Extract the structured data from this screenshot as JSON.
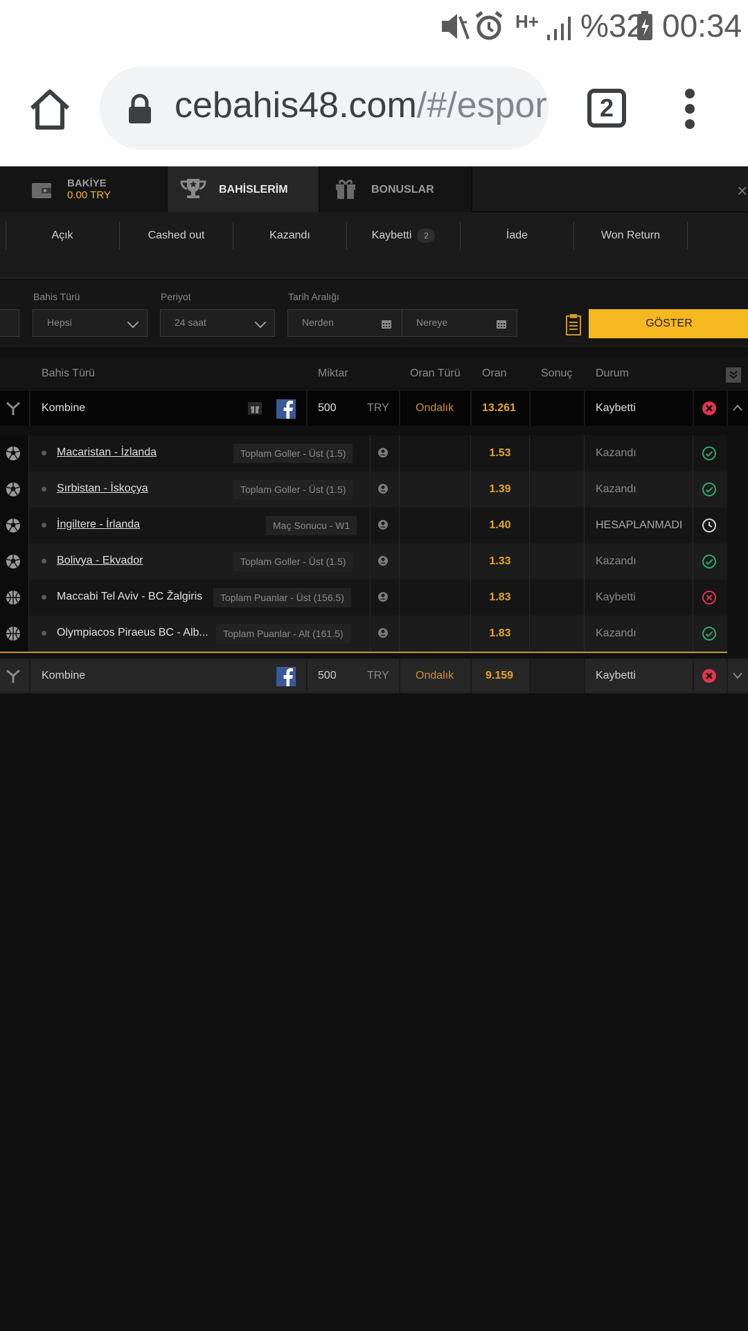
{
  "status_bar": {
    "battery": "%32",
    "time": "00:34",
    "network": "H+"
  },
  "browser": {
    "url_domain": "cebahis48.com",
    "url_path": "/#/espor",
    "tab_count": "2"
  },
  "top_nav": {
    "balance_label": "BAKİYE",
    "balance_value": "0.00 TRY",
    "bets_label": "BAHİSLERİM",
    "bonus_label": "BONUSLAR"
  },
  "filter_tabs": [
    {
      "label": "Açık"
    },
    {
      "label": "Cashed out"
    },
    {
      "label": "Kazandı"
    },
    {
      "label": "Kaybetti",
      "badge": "2"
    },
    {
      "label": "İade"
    },
    {
      "label": "Won Return"
    }
  ],
  "filters": {
    "bet_type_label": "Bahis Türü",
    "bet_type_value": "Hepsi",
    "period_label": "Periyot",
    "period_value": "24 saat",
    "date_range_label": "Tarih Aralığı",
    "from_placeholder": "Nerden",
    "to_placeholder": "Nereye",
    "show_button": "GÖSTER"
  },
  "table_headers": {
    "bet_type": "Bahis Türü",
    "amount": "Miktar",
    "odds_type": "Oran Türü",
    "odds": "Oran",
    "result": "Sonuç",
    "status": "Durum"
  },
  "bets": [
    {
      "type": "Kombine",
      "amount": "500",
      "currency": "TRY",
      "odds_type": "Ondalık",
      "odds": "13.261",
      "status": "Kaybetti",
      "selections": [
        {
          "match": "Macaristan - İzlanda",
          "market": "Toplam Goller - Üst (1.5)",
          "odds": "1.53",
          "status": "Kazandı",
          "sport": "football",
          "icon": "check"
        },
        {
          "match": "Sırbistan - İskoçya",
          "market": "Toplam Goller - Üst (1.5)",
          "odds": "1.39",
          "status": "Kazandı",
          "sport": "football",
          "icon": "check"
        },
        {
          "match": "İngiltere - İrlanda",
          "market": "Maç Sonucu - W1",
          "odds": "1.40",
          "status": "HESAPLANMADI",
          "sport": "football",
          "icon": "clock"
        },
        {
          "match": "Bolivya - Ekvador",
          "market": "Toplam Goller - Üst (1.5)",
          "odds": "1.33",
          "status": "Kazandı",
          "sport": "football",
          "icon": "check"
        },
        {
          "match": "Maccabi Tel Aviv - BC Žalgiris",
          "market": "Toplam Puanlar - Üst (156.5)",
          "odds": "1.83",
          "status": "Kaybetti",
          "sport": "basketball",
          "icon": "cross"
        },
        {
          "match": "Olympiacos Piraeus BC - Alb...",
          "market": "Toplam Puanlar - Alt (161.5)",
          "odds": "1.83",
          "status": "Kazandı",
          "sport": "basketball",
          "icon": "check"
        }
      ]
    },
    {
      "type": "Kombine",
      "amount": "500",
      "currency": "TRY",
      "odds_type": "Ondalık",
      "odds": "9.159",
      "status": "Kaybetti"
    }
  ],
  "colors": {
    "accent": "#f5b820",
    "odds": "#e5a527",
    "win": "#2ea86b",
    "lose": "#e0364b"
  }
}
